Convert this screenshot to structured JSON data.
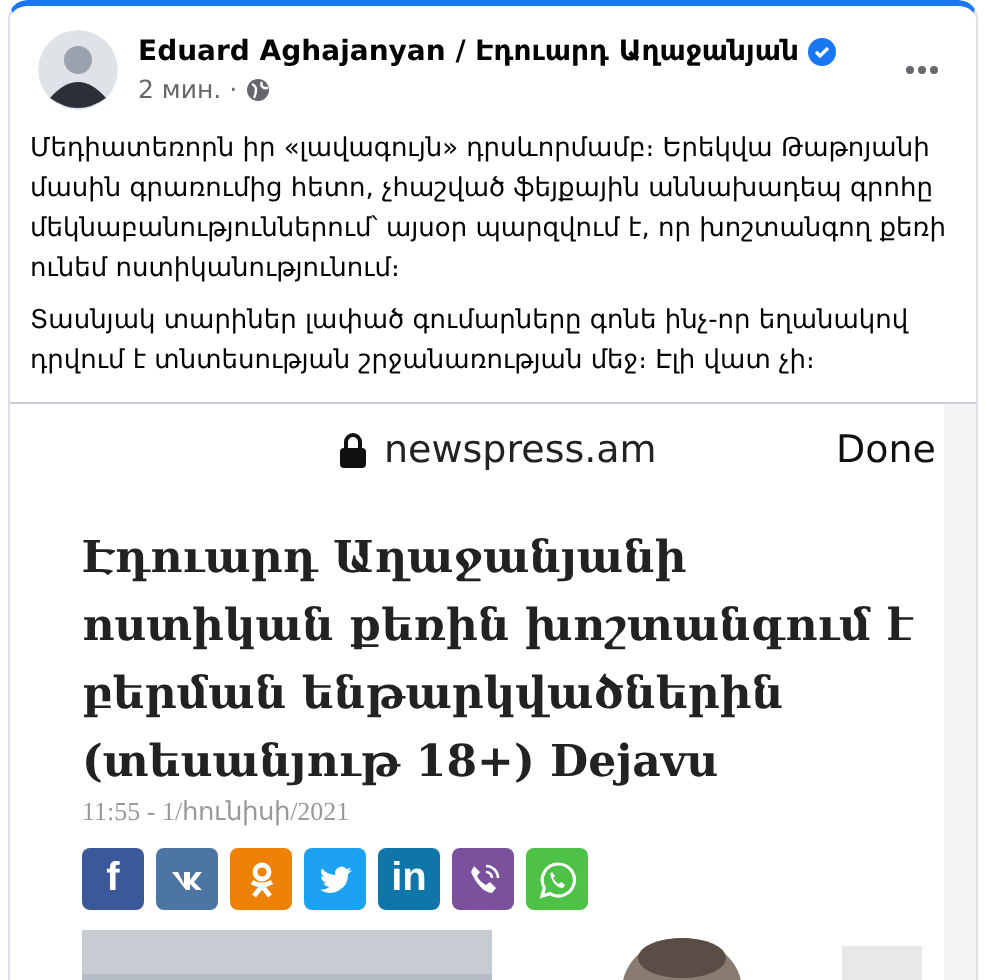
{
  "post": {
    "author": "Eduard Aghajanyan / Էդուարդ Աղաջանյան",
    "verified": true,
    "time": "2 мин.",
    "separator": "·",
    "paragraphs": [
      "Մեդիատեռորն իր «լավագույն» դրսևորմամբ։ Երեկվա Թաթոյանի մասին գրառումից հետո, չհաշված ֆեյքային աննախադեպ գրոհը մեկնաբանություններում՝ այսօր պարզվում է, որ խոշտանգող քեռի ունեմ ոստիկանությունում։",
      "Տասնյակ տարիներ լափած գումարները գոնե ինչ-որ եղանակով դրվում է տնտեսության շրջանառության մեջ։ Էլի վատ չի։"
    ]
  },
  "attachment": {
    "url": "newspress.am",
    "done": "Done",
    "headline": "Էդուարդ Աղաջանյանի ոստիկան քեռին խոշտանգում է բերման ենթարկվածներին (տեսանյութ 18+) Dejavu",
    "date": "11:55 - 1/հունիսի/2021",
    "share_buttons": [
      {
        "kind": "facebook",
        "label": "f",
        "color": "#3b5998"
      },
      {
        "kind": "vk",
        "color": "#4c75a3"
      },
      {
        "kind": "odnoklassniki",
        "color": "#ee8208"
      },
      {
        "kind": "twitter",
        "color": "#1da1f2"
      },
      {
        "kind": "linkedin",
        "label": "in",
        "color": "#0e76a8"
      },
      {
        "kind": "viber",
        "color": "#7b519d"
      },
      {
        "kind": "whatsapp",
        "color": "#4dc247"
      }
    ]
  }
}
